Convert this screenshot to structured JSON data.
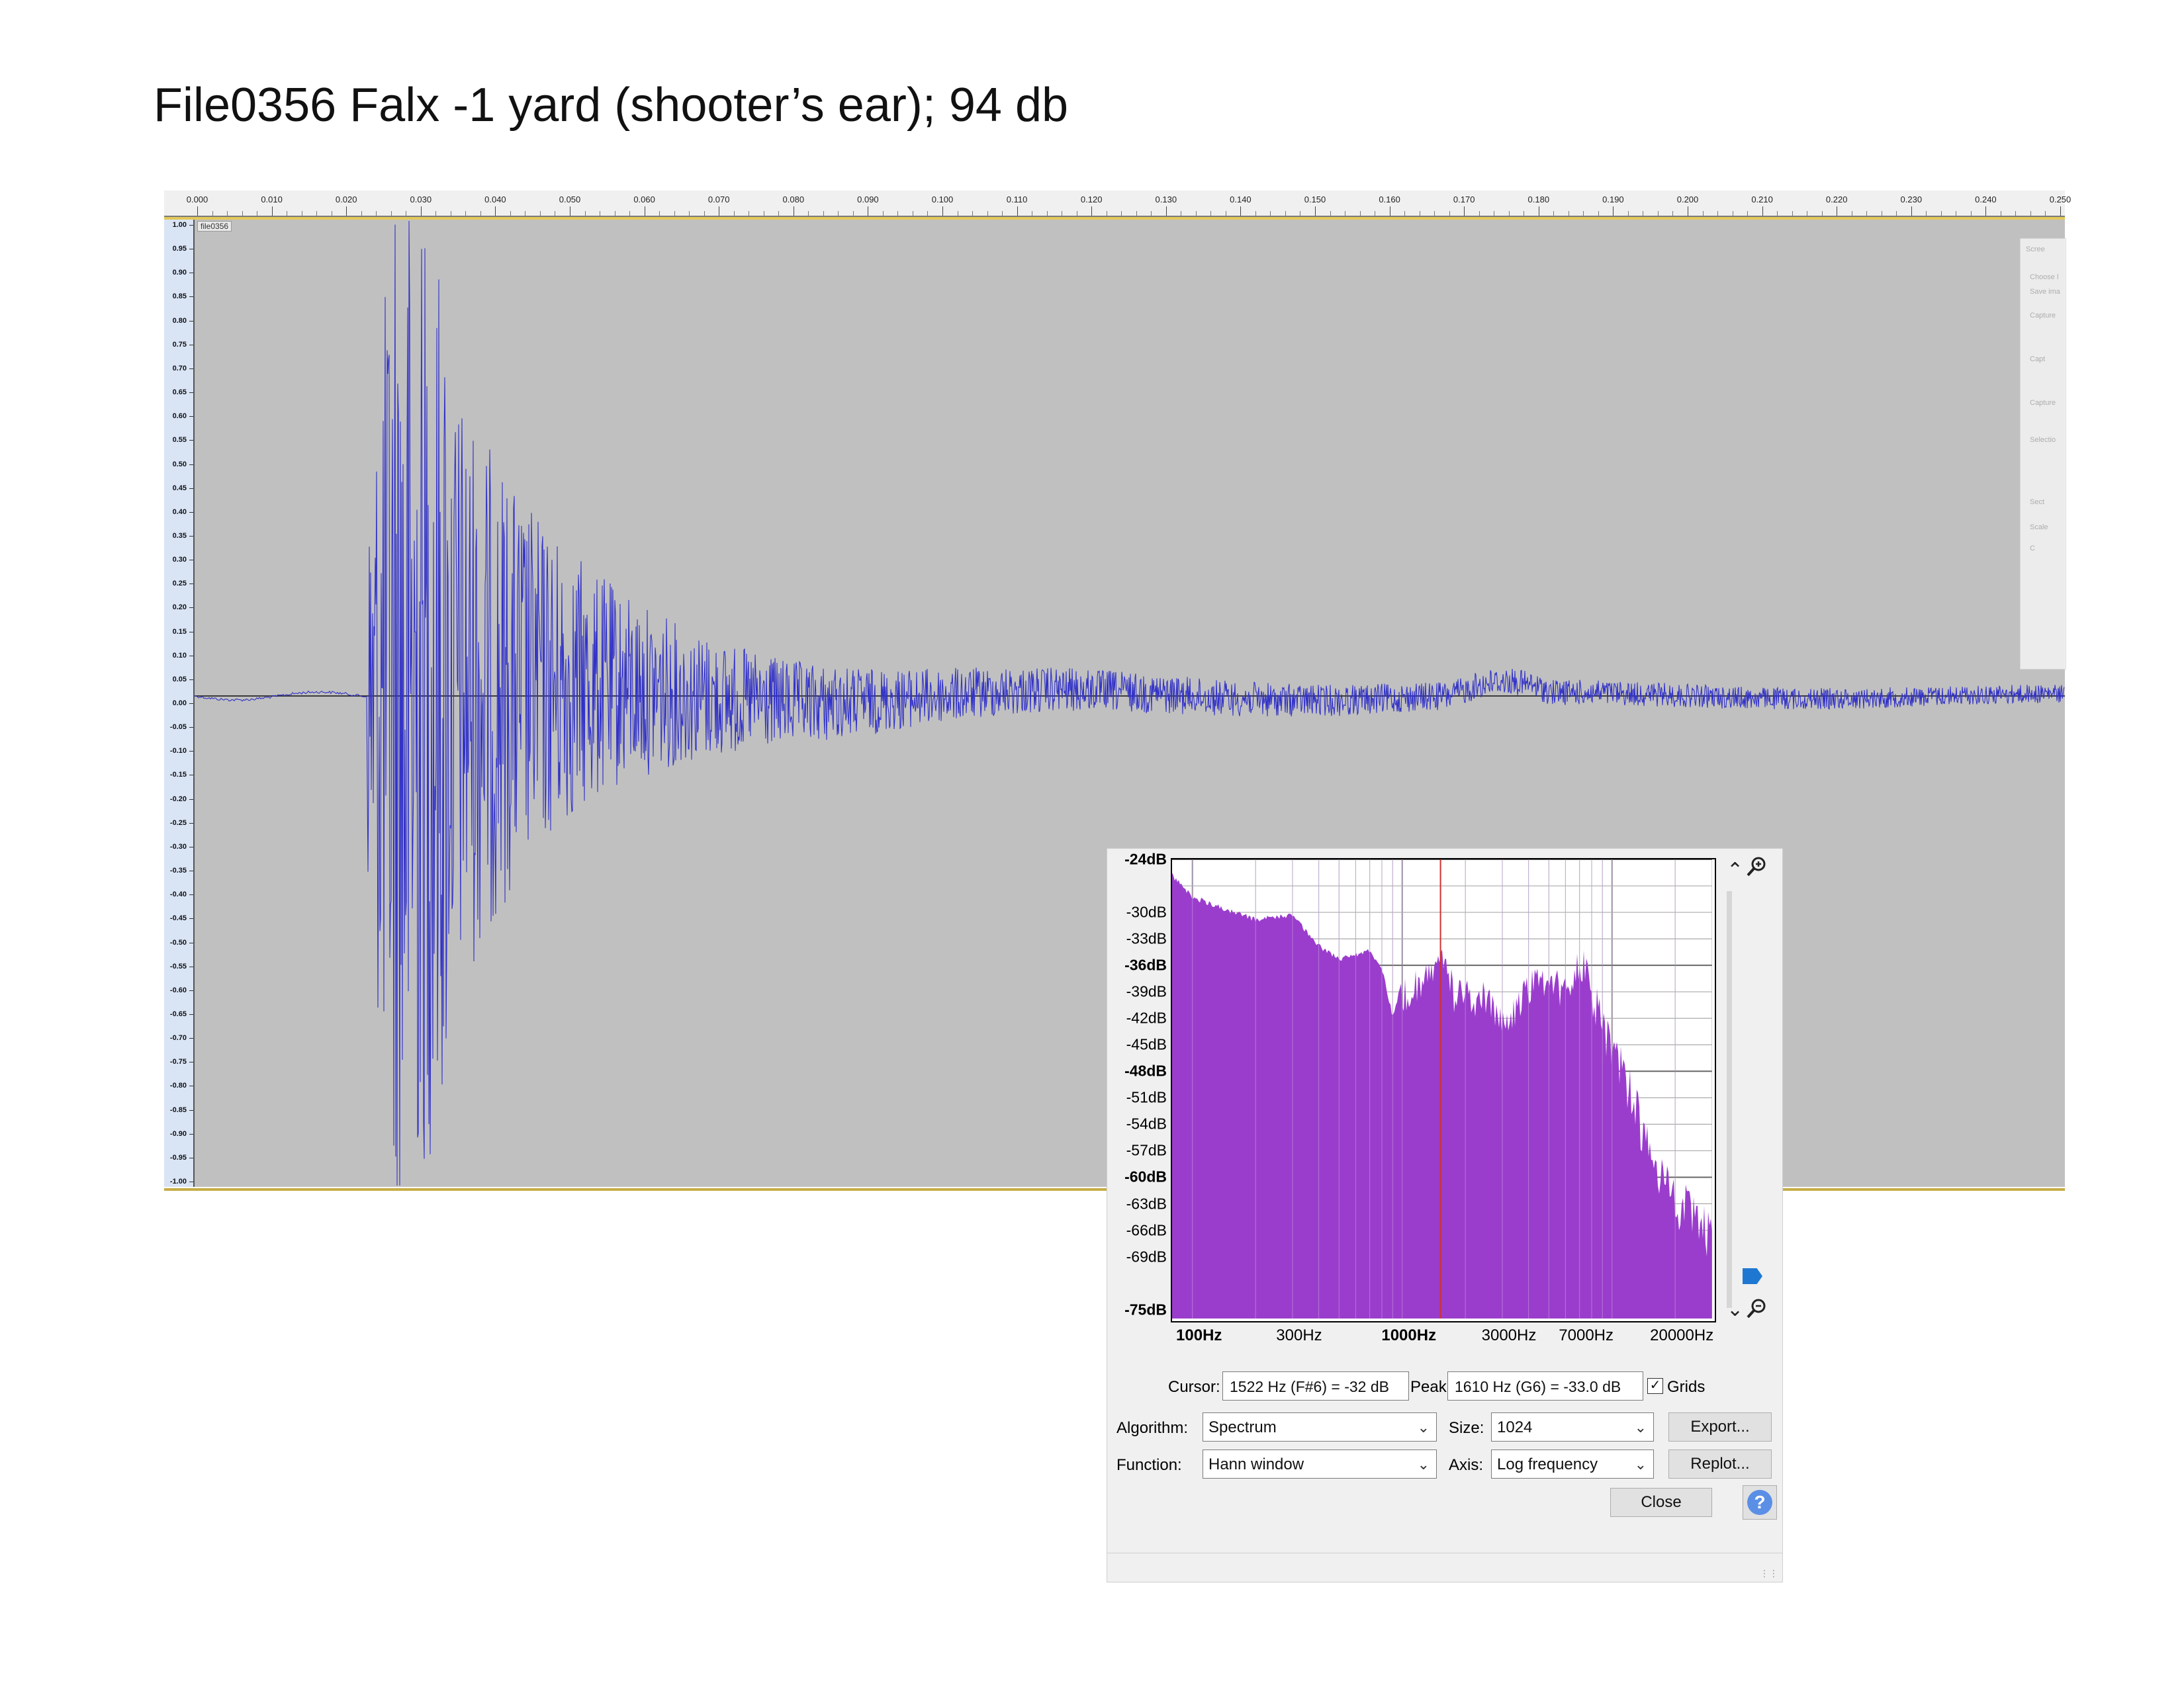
{
  "page": {
    "title": "File0356 Falx -1 yard (shooter’s ear); 94 db"
  },
  "track": {
    "name": "file0356",
    "timeline_ticks": [
      "0.000",
      "0.010",
      "0.020",
      "0.030",
      "0.040",
      "0.050",
      "0.060",
      "0.070",
      "0.080",
      "0.090",
      "0.100",
      "0.110",
      "0.120",
      "0.130",
      "0.140",
      "0.150",
      "0.160",
      "0.170",
      "0.180",
      "0.190",
      "0.200",
      "0.210",
      "0.220",
      "0.230",
      "0.240",
      "0.250"
    ],
    "amplitude_ticks": [
      "1.00",
      "0.95",
      "0.90",
      "0.85",
      "0.80",
      "0.75",
      "0.70",
      "0.65",
      "0.60",
      "0.55",
      "0.50",
      "0.45",
      "0.40",
      "0.35",
      "0.30",
      "0.25",
      "0.20",
      "0.15",
      "0.10",
      "0.05",
      "0.00",
      "-0.05",
      "-0.10",
      "-0.15",
      "-0.20",
      "-0.25",
      "-0.30",
      "-0.35",
      "-0.40",
      "-0.45",
      "-0.50",
      "-0.55",
      "-0.60",
      "-0.65",
      "-0.70",
      "-0.75",
      "-0.80",
      "-0.85",
      "-0.90",
      "-0.95",
      "-1.00"
    ],
    "waveform_color": "#3232c8",
    "background_color": "#c0c0c0"
  },
  "ghost_dialog": {
    "title": "Scree",
    "lines": [
      "Choose l",
      "Save ima",
      "Capture",
      "Capt",
      "Capture",
      "Selectio",
      "Sect",
      "Scale",
      "C"
    ]
  },
  "dialog": {
    "db_labels": [
      {
        "text": "-24dB",
        "bold": true
      },
      {
        "text": "-30dB",
        "bold": false
      },
      {
        "text": "-33dB",
        "bold": false
      },
      {
        "text": "-36dB",
        "bold": true
      },
      {
        "text": "-39dB",
        "bold": false
      },
      {
        "text": "-42dB",
        "bold": false
      },
      {
        "text": "-45dB",
        "bold": false
      },
      {
        "text": "-48dB",
        "bold": true
      },
      {
        "text": "-51dB",
        "bold": false
      },
      {
        "text": "-54dB",
        "bold": false
      },
      {
        "text": "-57dB",
        "bold": false
      },
      {
        "text": "-60dB",
        "bold": true
      },
      {
        "text": "-63dB",
        "bold": false
      },
      {
        "text": "-66dB",
        "bold": false
      },
      {
        "text": "-69dB",
        "bold": false
      },
      {
        "text": "-75dB",
        "bold": true
      }
    ],
    "hz_labels": [
      {
        "text": "100Hz",
        "bold": true
      },
      {
        "text": "300Hz",
        "bold": false
      },
      {
        "text": "1000Hz",
        "bold": true
      },
      {
        "text": "3000Hz",
        "bold": false
      },
      {
        "text": "7000Hz",
        "bold": false
      },
      {
        "text": "20000Hz",
        "bold": false
      }
    ],
    "cursor_label": "Cursor:",
    "cursor_value": "1522 Hz (F#6) = -32 dB",
    "peak_label": "Peak:",
    "peak_value": "1610 Hz (G6) = -33.0 dB",
    "grids_label": "Grids",
    "grids_checked": true,
    "algorithm_label": "Algorithm:",
    "algorithm_value": "Spectrum",
    "size_label": "Size:",
    "size_value": "1024",
    "export_label": "Export...",
    "function_label": "Function:",
    "function_value": "Hann window",
    "axis_label": "Axis:",
    "axis_value": "Log frequency",
    "replot_label": "Replot...",
    "close_label": "Close",
    "help_label": "?",
    "spectrum_color": "#9a3dcc",
    "cursor_line_color": "#d03030"
  },
  "chart_data": {
    "type": "area",
    "title": "",
    "xlabel": "",
    "ylabel": "",
    "x_scale": "log",
    "xlim": [
      80,
      30000
    ],
    "ylim": [
      -76,
      -24
    ],
    "grid": true,
    "x": [
      80,
      100,
      150,
      200,
      300,
      400,
      500,
      600,
      700,
      800,
      900,
      1000,
      1100,
      1200,
      1300,
      1400,
      1522,
      1610,
      1800,
      2000,
      2200,
      2500,
      3000,
      3500,
      4000,
      5000,
      6000,
      7000,
      8000,
      10000,
      12000,
      15000,
      20000,
      25000,
      30000
    ],
    "series": [
      {
        "values": [
          -25.5,
          -28.0,
          -29.5,
          -30.5,
          -30.0,
          -33.5,
          -35.0,
          -34.5,
          -34.0,
          -36.0,
          -41.5,
          -37.5,
          -37.0,
          -36.0,
          -35.0,
          -34.5,
          -32.0,
          -33.0,
          -38.5,
          -36.0,
          -39.0,
          -37.5,
          -41.0,
          -39.5,
          -36.5,
          -36.0,
          -37.0,
          -33.5,
          -35.5,
          -42.5,
          -47.0,
          -54.0,
          -60.0,
          -61.0,
          -64.0
        ]
      }
    ]
  }
}
